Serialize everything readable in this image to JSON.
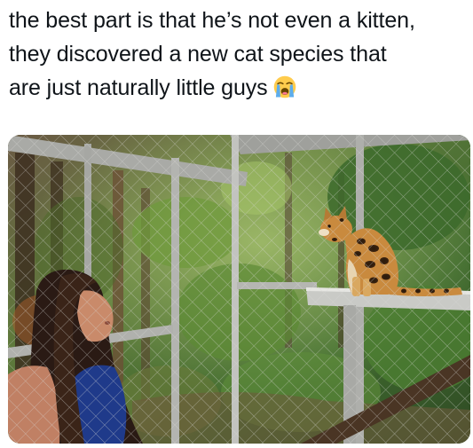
{
  "post": {
    "caption": "the best part is that he’s not even a kitten,\nthey discovered a new cat species that\nare just naturally little guys",
    "emoji_icon": "loudly-crying-face-icon"
  },
  "colors": {
    "text": "#0f1419",
    "background": "#ffffff",
    "foliage": "#4f7a36",
    "leopard_fur": "#c98a3e",
    "metal": "#b8b8b4"
  }
}
